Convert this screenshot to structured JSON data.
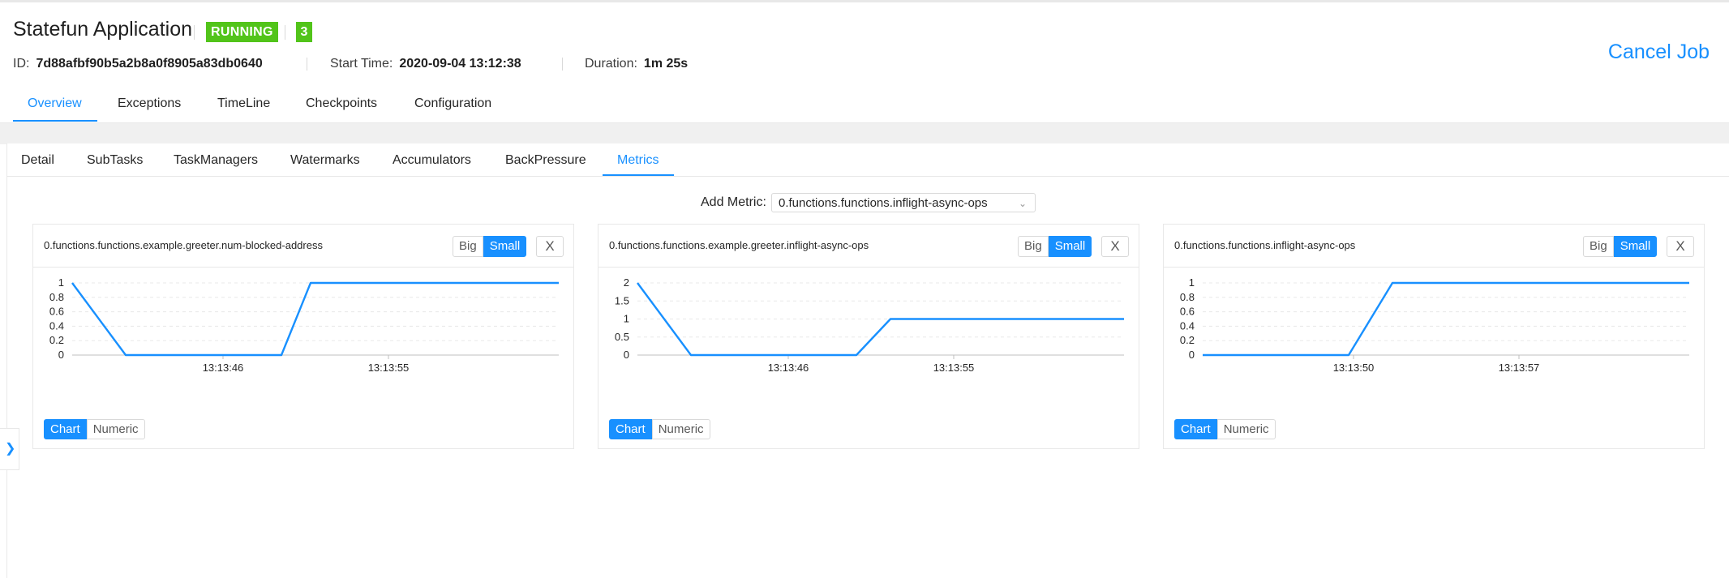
{
  "job": {
    "title": "Statefun Application",
    "status": "RUNNING",
    "running_count": "3",
    "id_label": "ID:",
    "id_value": "7d88afbf90b5a2b8a0f8905a83db0640",
    "start_label": "Start Time:",
    "start_value": "2020-09-04 13:12:38",
    "duration_label": "Duration:",
    "duration_value": "1m 25s",
    "cancel_label": "Cancel Job"
  },
  "main_tabs": [
    "Overview",
    "Exceptions",
    "TimeLine",
    "Checkpoints",
    "Configuration"
  ],
  "sub_tabs": [
    "Detail",
    "SubTasks",
    "TaskManagers",
    "Watermarks",
    "Accumulators",
    "BackPressure",
    "Metrics"
  ],
  "add_metric": {
    "label": "Add Metric:",
    "selected": "0.functions.functions.inflight-async-ops"
  },
  "card_buttons": {
    "big": "Big",
    "small": "Small",
    "close": "X",
    "chart": "Chart",
    "numeric": "Numeric"
  },
  "colors": {
    "accent": "#1890ff",
    "status_green": "#52c41a"
  },
  "icons": {
    "select": "chevron-down-icon",
    "sidebar": "chevron-right-icon"
  },
  "cards": [
    {
      "title": "0.functions.functions.example.greeter.num-blocked-address",
      "chart_data": {
        "type": "line",
        "series": [
          {
            "values": [
              1,
              0,
              0,
              1,
              1
            ]
          }
        ],
        "x": [
          0,
          0.11,
          0.43,
          0.49,
          1
        ],
        "y_ticks": [
          "0",
          "0.2",
          "0.4",
          "0.6",
          "0.8",
          "1"
        ],
        "ylim": [
          0,
          1
        ],
        "x_tick_labels": [
          {
            "label": "13:13:46",
            "pos": 0.31
          },
          {
            "label": "13:13:55",
            "pos": 0.65
          }
        ],
        "grid": true
      }
    },
    {
      "title": "0.functions.functions.example.greeter.inflight-async-ops",
      "chart_data": {
        "type": "line",
        "series": [
          {
            "values": [
              2,
              0,
              0,
              1,
              1
            ]
          }
        ],
        "x": [
          0,
          0.11,
          0.45,
          0.52,
          1
        ],
        "y_ticks": [
          "0",
          "0.5",
          "1",
          "1.5",
          "2"
        ],
        "ylim": [
          0,
          2
        ],
        "x_tick_labels": [
          {
            "label": "13:13:46",
            "pos": 0.31
          },
          {
            "label": "13:13:55",
            "pos": 0.65
          }
        ],
        "grid": true
      }
    },
    {
      "title": "0.functions.functions.inflight-async-ops",
      "chart_data": {
        "type": "line",
        "series": [
          {
            "values": [
              0,
              0,
              1,
              1
            ]
          }
        ],
        "x": [
          0,
          0.3,
          0.39,
          1
        ],
        "y_ticks": [
          "0",
          "0.2",
          "0.4",
          "0.6",
          "0.8",
          "1"
        ],
        "ylim": [
          0,
          1
        ],
        "x_tick_labels": [
          {
            "label": "13:13:50",
            "pos": 0.31
          },
          {
            "label": "13:13:57",
            "pos": 0.65
          }
        ],
        "grid": true
      }
    }
  ]
}
